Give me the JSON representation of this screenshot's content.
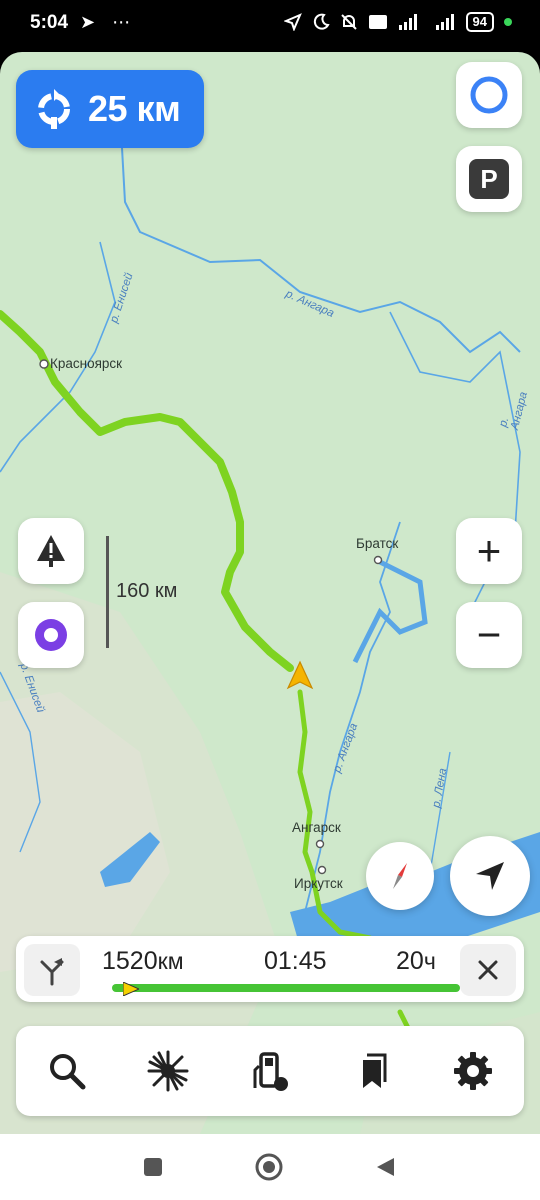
{
  "status_bar": {
    "time": "5:04",
    "left_icons": "➤ ⋯",
    "right_icons": [
      "location-arrow-icon",
      "moon-icon",
      "bell-off-icon",
      "volte-icon",
      "signal-icon",
      "h-plus-signal-icon"
    ],
    "battery": "94"
  },
  "maneuver": {
    "icon": "roundabout-icon",
    "distance": "25 км"
  },
  "map": {
    "cities": [
      {
        "name": "Красноярск"
      },
      {
        "name": "Братск"
      },
      {
        "name": "Ангарск"
      },
      {
        "name": "Иркутск"
      }
    ],
    "rivers": [
      "р. Енисей",
      "р. Ангара",
      "р. Ангара",
      "р. Ангара",
      "р. Лена",
      "р. Енисей"
    ],
    "scale_label": "160 км"
  },
  "buttons": {
    "alice_top_icon": "alice-circle-icon",
    "parking_label": "P",
    "zoom_in": "+",
    "zoom_out": "−",
    "warning_icon": "road-event-warning-icon",
    "alice_icon": "alice-voice-assistant-icon",
    "compass_icon": "compass-icon",
    "my_location_icon": "navigation-arrow-icon"
  },
  "route": {
    "distance_value": "1520",
    "distance_unit": "км",
    "time": "01:45",
    "eta_value": "20",
    "eta_unit": "ч",
    "progress": 0.06,
    "route_color": "#46c435"
  },
  "toolbar": {
    "items": [
      "search-icon",
      "traffic-icon",
      "gas-station-icon",
      "bookmarks-icon",
      "settings-icon"
    ]
  },
  "colors": {
    "accent": "#2b7cf0",
    "route": "#7ed321",
    "map_bg": "#cfe8cb",
    "water": "#5aa6e6"
  }
}
